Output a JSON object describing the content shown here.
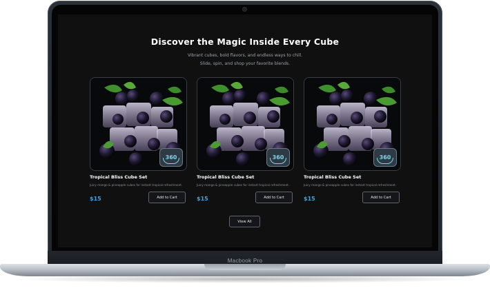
{
  "hero": {
    "title": "Discover the Magic Inside Every Cube",
    "subtitle_line1": "Vibrant cubes, bold flavors, and endless ways to chill.",
    "subtitle_line2": "Slide, spin, and shop your favorite blends."
  },
  "products": [
    {
      "title": "Tropical Bliss Cube Set",
      "description": "Juicy mango & pineapple cubes for instant tropical refreshment.",
      "price": "$15",
      "cta": "Add to Cart",
      "badge": "360"
    },
    {
      "title": "Tropical Bliss Cube Set",
      "description": "Juicy mango & pineapple cubes for instant tropical refreshment.",
      "price": "$15",
      "cta": "Add to Cart",
      "badge": "360"
    },
    {
      "title": "Tropical Bliss Cube Set",
      "description": "Juicy mango & pineapple cubes for instant tropical refreshment.",
      "price": "$15",
      "cta": "Add to Cart",
      "badge": "360"
    }
  ],
  "view_all_label": "View All",
  "device_label": "Macbook Pro",
  "colors": {
    "background": "#101011",
    "price": "#4aa3d8",
    "badge_accent": "#7fd4ea"
  },
  "icons": {
    "rotate_360": "rotate-360-icon"
  }
}
